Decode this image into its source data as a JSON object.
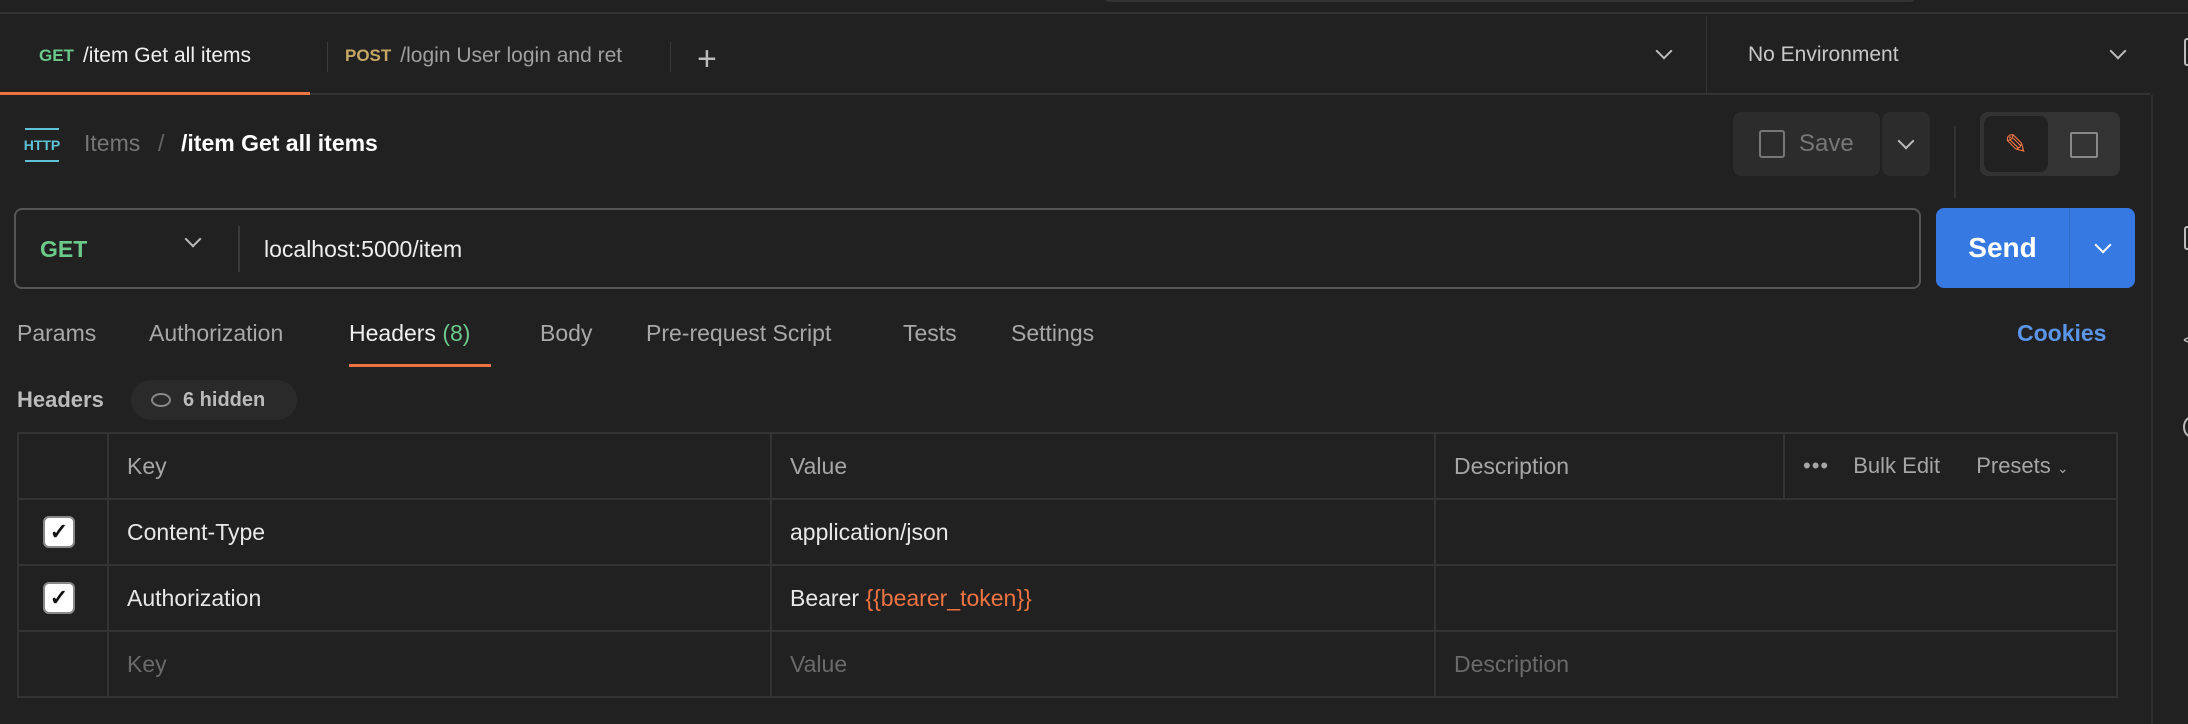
{
  "tabs": [
    {
      "method": "GET",
      "label": "/item Get all items",
      "method_color": "#6bc98a",
      "active": true
    },
    {
      "method": "POST",
      "label": "/login User login and ret",
      "method_color": "#c6a865",
      "active": false
    }
  ],
  "environment": "No Environment",
  "breadcrumb": {
    "icon_label": "HTTP",
    "parent": "Items",
    "separator": "/",
    "current": "/item Get all items"
  },
  "toolbar": {
    "save_label": "Save"
  },
  "request": {
    "method": "GET",
    "url": "localhost:5000/item",
    "send_label": "Send"
  },
  "subtabs": [
    {
      "label": "Params"
    },
    {
      "label": "Authorization"
    },
    {
      "label": "Headers",
      "count": "(8)",
      "active": true
    },
    {
      "label": "Body"
    },
    {
      "label": "Pre-request Script"
    },
    {
      "label": "Tests"
    },
    {
      "label": "Settings"
    }
  ],
  "cookies_label": "Cookies",
  "headers_section": {
    "title": "Headers",
    "hidden_label": "6 hidden"
  },
  "table": {
    "columns": {
      "key": "Key",
      "value": "Value",
      "description": "Description",
      "bulk_edit": "Bulk Edit",
      "presets": "Presets"
    },
    "rows": [
      {
        "checked": true,
        "key": "Content-Type",
        "value": "application/json",
        "value_var": ""
      },
      {
        "checked": true,
        "key": "Authorization",
        "value": "Bearer ",
        "value_var": "{{bearer_token}}"
      }
    ],
    "placeholders": {
      "key": "Key",
      "value": "Value",
      "description": "Description"
    }
  },
  "colors": {
    "accent": "#ef7443",
    "send": "#3779e3",
    "cookies": "#5b95ea",
    "variable": "#ef7443"
  }
}
